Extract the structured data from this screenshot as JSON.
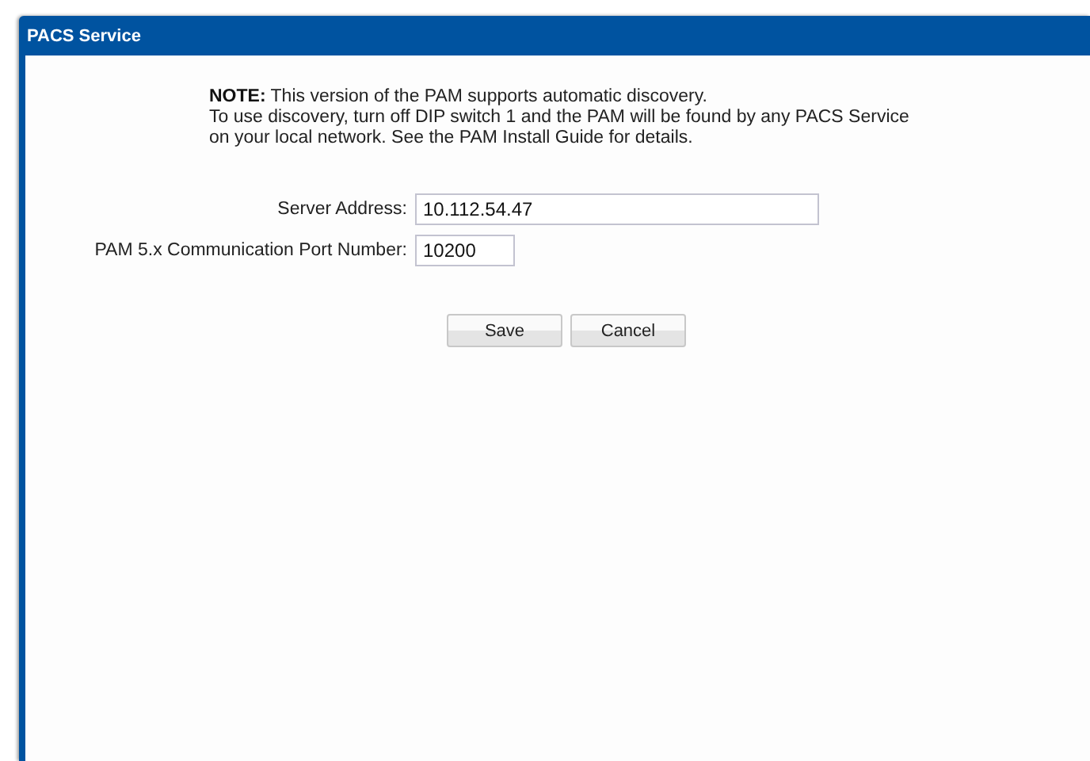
{
  "window": {
    "title": "PACS Service"
  },
  "note": {
    "lead": "**NOTE:** This version of the PAM supports automatic discovery.",
    "body": "To use discovery, turn off DIP switch 1 and the PAM will be found by any PACS Service on your local network. See the PAM Install Guide for details."
  },
  "fields": [
    {
      "label": "Server Address:",
      "value": "10.112.54.47",
      "kind": "wide"
    },
    {
      "label": "PAM 5.x Communication Port Number:",
      "value": "10200",
      "kind": "short"
    }
  ],
  "buttons": [
    "Save",
    "Cancel"
  ]
}
